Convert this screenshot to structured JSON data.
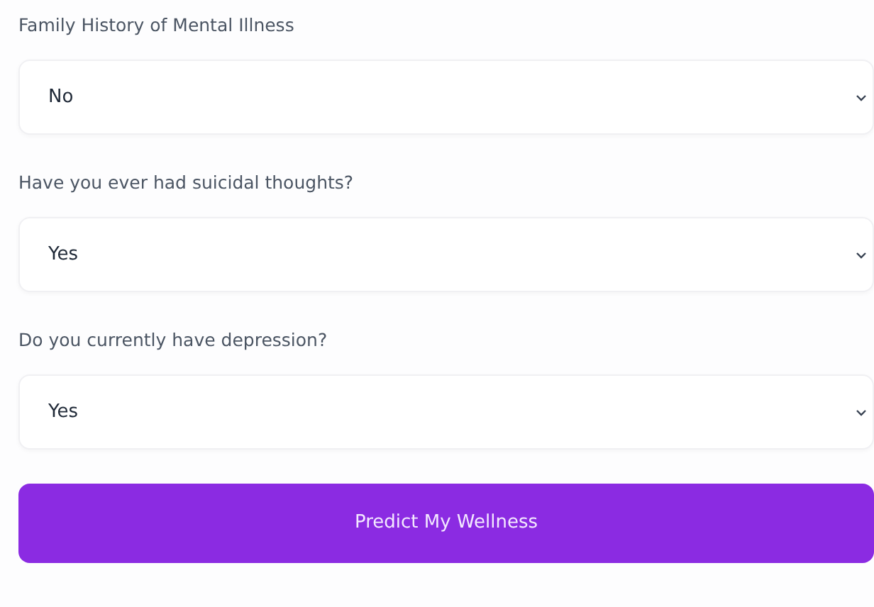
{
  "fields": [
    {
      "label": "Family History of Mental Illness",
      "value": "No"
    },
    {
      "label": "Have you ever had suicidal thoughts?",
      "value": "Yes"
    },
    {
      "label": "Do you currently have depression?",
      "value": "Yes"
    }
  ],
  "submit_button": {
    "label": "Predict My Wellness"
  }
}
